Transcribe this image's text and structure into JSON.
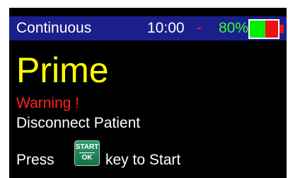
{
  "status_bar": {
    "mode": "Continuous",
    "time": "10:00",
    "separator": "-",
    "battery_percent": "80%",
    "battery_level": 0.8,
    "battery_icon": "battery-icon"
  },
  "screen": {
    "title": "Prime",
    "warning": "Warning !",
    "instruction": "Disconnect Patient",
    "press_prefix": "Press",
    "press_suffix": "key to Start",
    "start_key": {
      "top_label": "START",
      "bottom_label": "OK"
    }
  },
  "colors": {
    "screen_bg": "#000000",
    "status_bg": "#1a1f8c",
    "title": "#ffff00",
    "warning": "#ff2020",
    "battery_percent": "#33ff33",
    "battery_fill": "#00ee00",
    "battery_low": "#ee1111"
  }
}
